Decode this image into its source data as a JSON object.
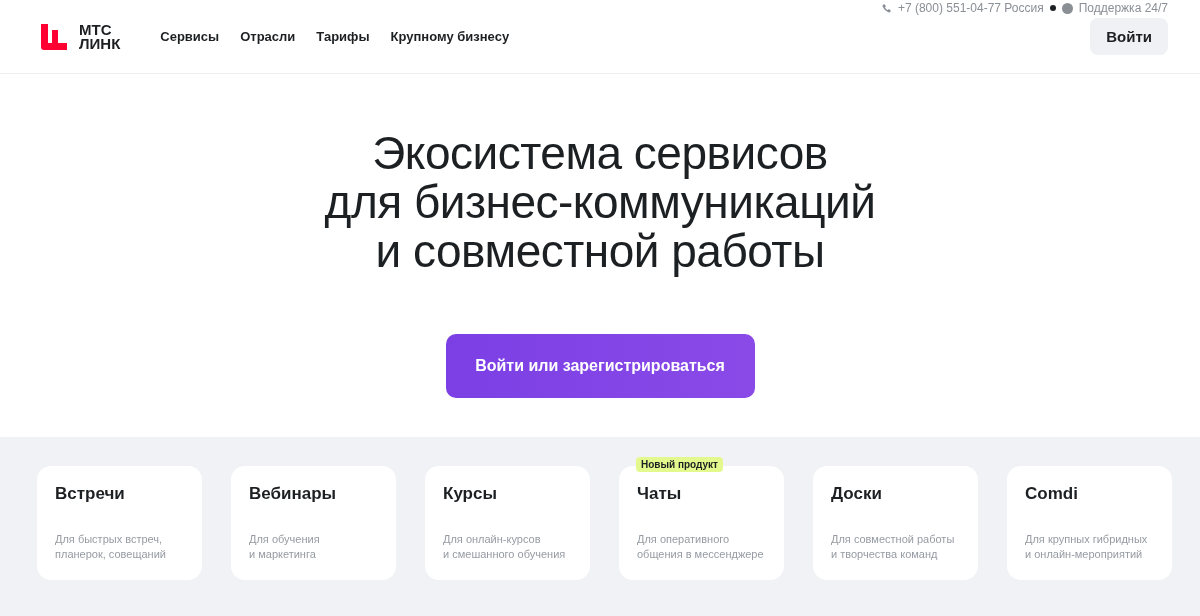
{
  "header": {
    "logo": {
      "line_1": "МТС",
      "line_2": "ЛИНК"
    },
    "nav": [
      "Сервисы",
      "Отрасли",
      "Тарифы",
      "Крупному бизнесу"
    ],
    "phone": "+7 (800) 551-04-77 Россия",
    "support": "Поддержка 24/7",
    "login_button": "Войти"
  },
  "hero": {
    "title": "Экосистема сервисов\nдля бизнес-коммуникаций\nи совместной работы",
    "cta_button": "Войти или зарегистрироваться"
  },
  "products": [
    {
      "title": "Встречи",
      "description": "Для быстрых встреч,\nпланерок, совещаний"
    },
    {
      "title": "Вебинары",
      "description": "Для обучения\nи маркетинга"
    },
    {
      "title": "Курсы",
      "description": "Для онлайн-курсов\nи смешанного обучения"
    },
    {
      "title": "Чаты",
      "description": "Для оперативного\nобщения в мессенджере",
      "badge": "Новый продукт"
    },
    {
      "title": "Доски",
      "description": "Для совместной работы\nи творчества команд"
    },
    {
      "title": "Comdi",
      "description": "Для крупных гибридных\nи онлайн-мероприятий"
    }
  ]
}
